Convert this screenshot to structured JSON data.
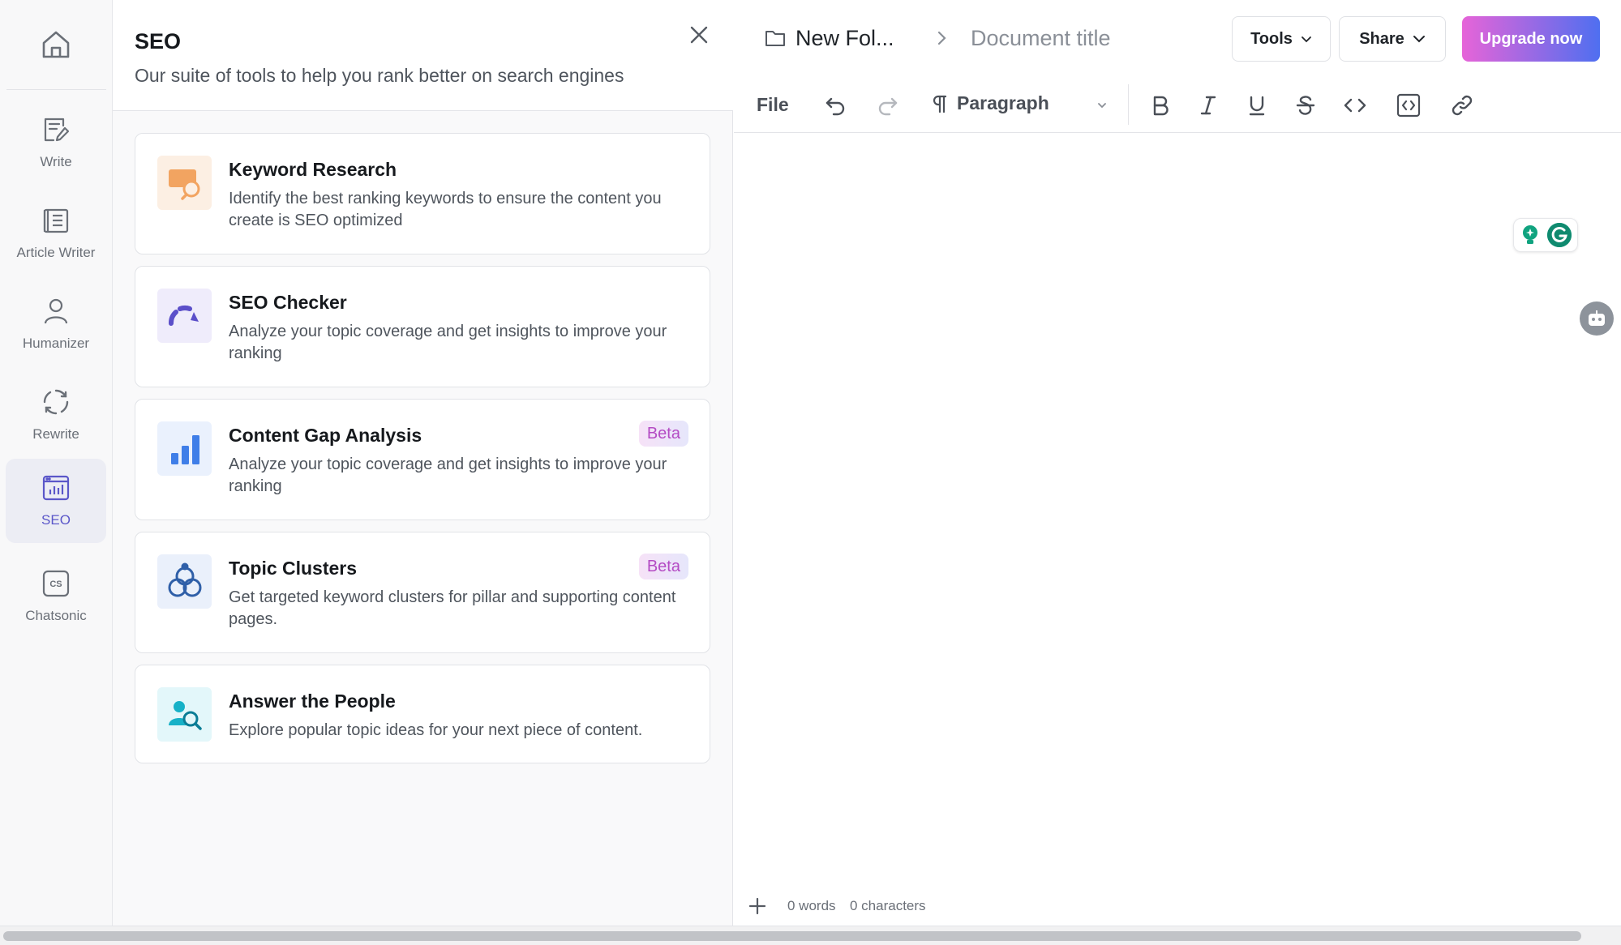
{
  "nav": {
    "items": [
      {
        "label": "Write",
        "icon": "write-icon"
      },
      {
        "label": "Article Writer",
        "icon": "article-icon"
      },
      {
        "label": "Humanizer",
        "icon": "person-icon"
      },
      {
        "label": "Rewrite",
        "icon": "rewrite-icon"
      },
      {
        "label": "SEO",
        "icon": "seo-icon",
        "active": true
      },
      {
        "label": "Chatsonic",
        "icon": "cs-icon",
        "badge": "CS"
      }
    ]
  },
  "panel": {
    "title": "SEO",
    "subtitle": "Our suite of tools to help you rank better on search engines",
    "cards": [
      {
        "title": "Keyword Research",
        "desc": "Identify the best ranking keywords to ensure the content you create is SEO optimized",
        "icon": "keyword-research-icon"
      },
      {
        "title": "SEO Checker",
        "desc": "Analyze your topic coverage and get insights to improve your ranking",
        "icon": "gauge-icon"
      },
      {
        "title": "Content Gap Analysis",
        "desc": "Analyze your topic coverage and get insights to improve your ranking",
        "badge": "Beta",
        "icon": "bar-chart-icon"
      },
      {
        "title": "Topic Clusters",
        "desc": "Get targeted keyword clusters for pillar and supporting content pages.",
        "badge": "Beta",
        "icon": "clusters-icon"
      },
      {
        "title": "Answer the People",
        "desc": "Explore popular topic ideas for your next piece of content.",
        "icon": "people-search-icon"
      }
    ]
  },
  "editor": {
    "breadcrumb": {
      "folder": "New Fol...",
      "document": "Document title"
    },
    "buttons": {
      "tools": "Tools",
      "share": "Share",
      "upgrade": "Upgrade now"
    },
    "toolbar": {
      "file": "File",
      "block_type": "Paragraph"
    },
    "status": {
      "words": "0 words",
      "characters": "0 characters"
    }
  },
  "colors": {
    "accent": "#5b57c9",
    "upgrade_start": "#e664d8",
    "upgrade_end": "#4f6ff0",
    "beta_text": "#b44bc4"
  }
}
